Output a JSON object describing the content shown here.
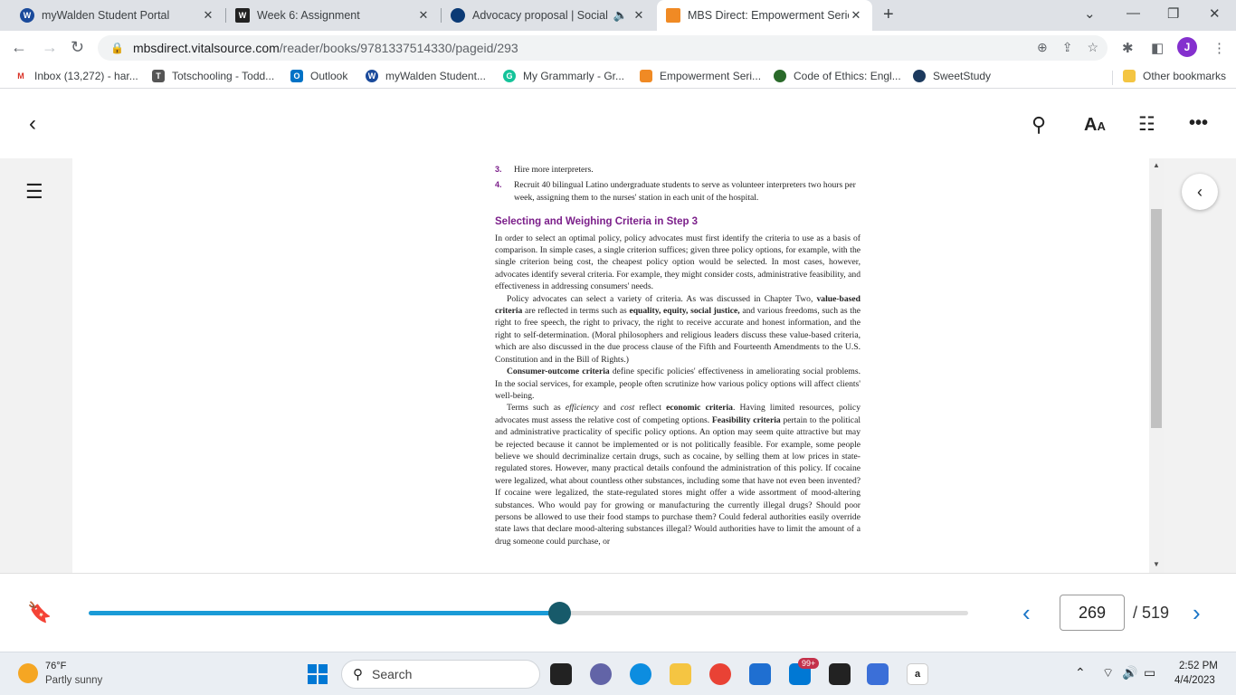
{
  "browser": {
    "tabs": [
      {
        "title": "myWalden Student Portal",
        "favicon": "W",
        "color": "#1a4a9b"
      },
      {
        "title": "Week 6: Assignment",
        "favicon": "W",
        "color": "#222222"
      },
      {
        "title": "Advocacy proposal | Social S",
        "favicon": "",
        "color": "#0b3a75"
      },
      {
        "title": "MBS Direct: Empowerment Series",
        "favicon": "",
        "color": "#f08a24"
      }
    ],
    "new_tab": "+",
    "url_host": "mbsdirect.vitalsource.com",
    "url_path": "/reader/books/9781337514330/pageid/293",
    "profile_initial": "J",
    "bookmarks": [
      {
        "label": "Inbox (13,272) - har...",
        "color": "#d93025",
        "icon": "M"
      },
      {
        "label": "Totschooling - Todd...",
        "color": "#555555",
        "icon": "T"
      },
      {
        "label": "Outlook",
        "color": "#0072c6",
        "icon": "O"
      },
      {
        "label": "myWalden Student...",
        "color": "#1a4a9b",
        "icon": "W"
      },
      {
        "label": "My Grammarly - Gr...",
        "color": "#15c39a",
        "icon": "G"
      },
      {
        "label": "Empowerment Seri...",
        "color": "#f08a24",
        "icon": ""
      },
      {
        "label": "Code of Ethics: Engl...",
        "color": "#2a6a2a",
        "icon": ""
      },
      {
        "label": "SweetStudy",
        "color": "#1c3a5e",
        "icon": ""
      }
    ],
    "other_bookmarks": "Other bookmarks"
  },
  "reader": {
    "list_items": [
      {
        "num": "3.",
        "text": "Hire more interpreters."
      },
      {
        "num": "4.",
        "text": "Recruit 40 bilingual Latino undergraduate students to serve as volunteer interpreters two hours per week, assigning them to the nurses' station in each unit of the hospital."
      }
    ],
    "heading": "Selecting and Weighing Criteria in Step 3",
    "p1": "In order to select an optimal policy, policy advocates must first identify the criteria to use as a basis of comparison. In simple cases, a single criterion suffices; given three policy options, for example, with the single criterion being cost, the cheapest policy option would be selected. In most cases, however, advocates identify several criteria. For example, they might consider costs, administrative feasibility, and effectiveness in addressing consumers' needs.",
    "p2_a": "Policy advocates can select a variety of criteria. As was discussed in Chapter Two, ",
    "p2_b1": "value-based criteria",
    "p2_c": " are reflected in terms such as ",
    "p2_b2": "equality, equity, social justice,",
    "p2_d": " and various freedoms, such as the right to free speech, the right to privacy, the right to receive accurate and honest information, and the right to self-determination. (Moral philosophers and religious leaders discuss these value-based criteria, which are also discussed in the due process clause of the Fifth and Fourteenth Amendments to the U.S. Constitution and in the Bill of Rights.)",
    "p3_b": "Consumer-outcome criteria",
    "p3_rest": " define specific policies' effectiveness in ameliorating social problems. In the social services, for example, people often scrutinize how various policy options will affect clients' well-being.",
    "p4_a": "Terms such as ",
    "p4_i1": "efficiency",
    "p4_and": " and ",
    "p4_i2": "cost",
    "p4_b": " reflect ",
    "p4_b1": "economic criteria",
    "p4_c": ". Having limited resources, policy advocates must assess the relative cost of competing options. ",
    "p4_b2": "Feasibility criteria",
    "p4_d": " pertain to the political and administrative practicality of specific policy options. An option may seem quite attractive but may be rejected because it cannot be implemented or is not politically feasible. For example, some people believe we should decriminalize certain drugs, such as cocaine, by selling them at low prices in state-regulated stores. However, many practical details confound the administration of this policy. If cocaine were legalized, what about countless other substances, including some that have not even been invented? If cocaine were legalized, the state-regulated stores might offer a wide assortment of mood-altering substances. Who would pay for growing or manufacturing the currently illegal drugs? Should poor persons be allowed to use their food stamps to purchase them? Could federal authorities easily override state laws that declare mood-altering substances illegal? Would authorities have to limit the amount of a drug someone could purchase, or"
  },
  "pager": {
    "current_page": "269",
    "total": "/ 519",
    "progress": 0.535
  },
  "taskbar": {
    "temp": "76°F",
    "weather": "Partly sunny",
    "search": "Search",
    "mail_badge": "99+",
    "time": "2:52 PM",
    "date": "4/4/2023"
  }
}
